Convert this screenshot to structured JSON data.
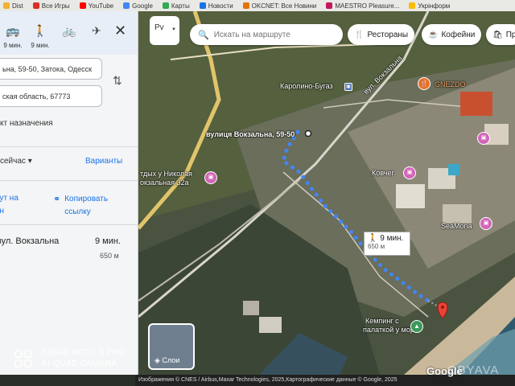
{
  "bookmarks": [
    {
      "label": "Dist",
      "icon": "folder-icon",
      "color": "#f2b134"
    },
    {
      "label": "Все Игры",
      "icon": "gmail-icon",
      "color": "#d93025"
    },
    {
      "label": "YouTube",
      "icon": "youtube-icon",
      "color": "#ff0000"
    },
    {
      "label": "Google",
      "icon": "google-icon",
      "color": "#4285f4"
    },
    {
      "label": "Карты",
      "icon": "maps-icon",
      "color": "#34a853"
    },
    {
      "label": "Новости",
      "icon": "news-icon",
      "color": "#1a73e8"
    },
    {
      "label": "OKCNET: Все Новини",
      "icon": "news-icon",
      "color": "#e37400"
    },
    {
      "label": "MAESTRO Pleasure...",
      "icon": "bookmark-icon",
      "color": "#c2185b"
    },
    {
      "label": "Укрінформ",
      "icon": "bookmark-icon",
      "color": "#fbbc04"
    }
  ],
  "panel": {
    "modes": [
      {
        "name": "transit",
        "icon": "transit-icon",
        "glyph": "🚌",
        "time": "9 мин."
      },
      {
        "name": "walk",
        "icon": "walk-icon",
        "glyph": "🚶",
        "time": "9 мин."
      },
      {
        "name": "bike",
        "icon": "bike-icon",
        "glyph": "🚲",
        "time": ""
      },
      {
        "name": "flight",
        "icon": "airplane-icon",
        "glyph": "✈",
        "time": ""
      }
    ],
    "close_glyph": "✕",
    "origin_value": "ьна, 59-50, Затока, Одесск",
    "destination_value": "ская область, 67773",
    "swap_glyph": "⇅",
    "add_destination": "кт назначения",
    "depart_label": "сейчас ▾",
    "options_label": "Варианты",
    "send_route": "рут на\nон",
    "copy_link": "Копировать\nссылку",
    "route_name": "вул. Вокзальна",
    "route_time": "9 мин.",
    "route_distance": "650 м",
    "collapse_glyph": "◀"
  },
  "map": {
    "layers_label": "Рv",
    "search_placeholder": "Искать на маршруте",
    "chips": [
      {
        "label": "Рестораны",
        "icon": "restaurant-icon",
        "glyph": "🍴"
      },
      {
        "label": "Кофейни",
        "icon": "coffee-icon",
        "glyph": "☕"
      },
      {
        "label": "Пр",
        "icon": "shopping-icon",
        "glyph": "🛍"
      }
    ],
    "labels": {
      "street_vokzalna": "вул. Вокзальна",
      "karolino": "Каролино-Бугаз",
      "gnezdo": "GNEZDO",
      "address": "вулиця Вокзальна, 59-50",
      "otdykh_1": "тдых у Николая",
      "otdykh_2": "окзальная 32а",
      "kovcheg": "Ковчег",
      "seamona": "SeaMona",
      "camping_1": "Кемпинг с",
      "camping_2": "палаткой у моря"
    },
    "walk_tooltip": {
      "time": "9 мин.",
      "distance": "650 м"
    },
    "layers_tile_label": "Слои",
    "attribution": "Изображения © CNES / Airbus,Maxar Technologies, 2025,Картографические данные © Google, 2025",
    "google_logo": "Google",
    "watermark": "OBYAVA"
  },
  "camera": {
    "line1": "REDMI NOTE 9 PRO",
    "line2": "AI QUAD CAMERA"
  },
  "colors": {
    "route_blue": "#4285f4",
    "destination_red": "#ea4335",
    "link_blue": "#1a73e8"
  }
}
